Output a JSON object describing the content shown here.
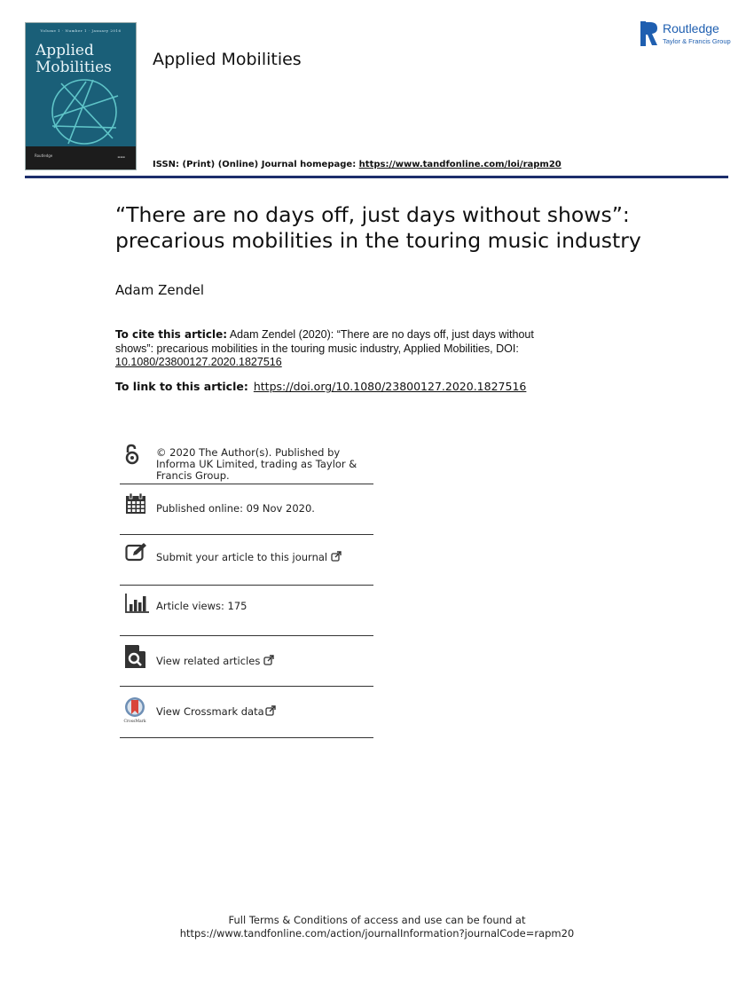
{
  "cover": {
    "volume_line": "Volume 1 · Number 1 · January 2016",
    "title_line1": "Applied",
    "title_line2": "Mobilities",
    "publisher": "Routledge"
  },
  "header": {
    "journal_name": "Applied Mobilities",
    "publisher_name": "Routledge",
    "publisher_group": "Taylor & Francis Group",
    "issn_text": "ISSN: (Print) (Online) Journal homepage: ",
    "homepage_url": "https://www.tandfonline.com/loi/rapm20"
  },
  "article": {
    "title": "“There are no days off, just days without shows”: precarious mobilities in the touring music industry",
    "author": "Adam Zendel",
    "cite_label": "To cite this article:",
    "cite_text": " Adam Zendel (2020): “There are no days off, just days without shows”: precarious mobilities in the touring music industry, Applied Mobilities, DOI: ",
    "cite_doi": "10.1080/23800127.2020.1827516",
    "link_label": "To link to this article:",
    "link_url": "https://doi.org/10.1080/23800127.2020.1827516"
  },
  "info_items": [
    {
      "icon": "open-access-icon",
      "text": "© 2020 The Author(s). Published by Informa UK Limited, trading as Taylor & Francis Group."
    },
    {
      "icon": "calendar-icon",
      "text": "Published online: 09 Nov 2020."
    },
    {
      "icon": "edit-icon",
      "text": "Submit your article to this journal"
    },
    {
      "icon": "bar-chart-icon",
      "text": "Article views: 175"
    },
    {
      "icon": "search-document-icon",
      "text": "View related articles"
    },
    {
      "icon": "crossmark-icon",
      "text": "View Crossmark data",
      "badge": "CrossMark"
    }
  ],
  "footer": {
    "line1": "Full Terms & Conditions of access and use can be found at",
    "line2": "https://www.tandfonline.com/action/journalInformation?journalCode=rapm20"
  },
  "colors": {
    "rule": "#1c2d6b",
    "routledge_blue": "#1f5fb0",
    "cover_teal": "#1a5f78"
  }
}
